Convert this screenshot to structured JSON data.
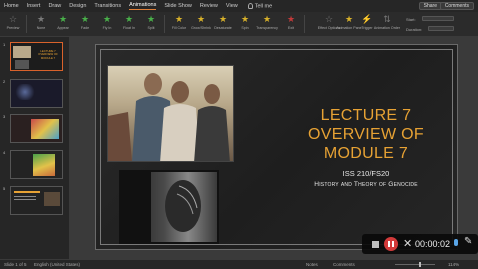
{
  "menubar": {
    "items": [
      "Home",
      "Insert",
      "Draw",
      "Design",
      "Transitions",
      "Animations",
      "Slide Show",
      "Review",
      "View"
    ],
    "active": "Animations",
    "tell_me": "Tell me",
    "share_label": "Share",
    "comments_label": "Comments"
  },
  "ribbon": {
    "preview_label": "Preview",
    "effects": [
      {
        "label": "None",
        "icon": "star-gray-icon"
      },
      {
        "label": "Appear",
        "icon": "star-green-icon"
      },
      {
        "label": "Fade",
        "icon": "star-green-icon"
      },
      {
        "label": "Fly In",
        "icon": "star-green-icon"
      },
      {
        "label": "Float In",
        "icon": "star-green-icon"
      },
      {
        "label": "Split",
        "icon": "star-green-icon"
      },
      {
        "label": "Wipe",
        "icon": "star-green-icon"
      },
      {
        "label": "Fill Color",
        "icon": "star-yellow-icon"
      },
      {
        "label": "Grow/Shrink",
        "icon": "star-yellow-icon"
      },
      {
        "label": "Desaturate",
        "icon": "star-yellow-icon"
      },
      {
        "label": "Spin",
        "icon": "star-yellow-icon"
      },
      {
        "label": "Transparency",
        "icon": "star-yellow-icon"
      },
      {
        "label": "Exit",
        "icon": "star-red-icon"
      }
    ],
    "effect_options": "Effect Options",
    "animation_pane": "Animation Pane",
    "trigger": "Trigger",
    "reorder": "Animation Order",
    "start_label": "Start:",
    "duration_label": "Duration:"
  },
  "thumbnails": [
    {
      "num": "1",
      "title": "LECTURE 7 OVERVIEW OF MODULE 7"
    },
    {
      "num": "2",
      "title": ""
    },
    {
      "num": "3",
      "title": ""
    },
    {
      "num": "4",
      "title": ""
    },
    {
      "num": "5",
      "title": ""
    }
  ],
  "slide": {
    "title_line1": "LECTURE 7",
    "title_line2": "OVERVIEW OF",
    "title_line3": "MODULE 7",
    "course": "ISS 210/FS20",
    "course_title": "History and Theory of Genocide"
  },
  "statusbar": {
    "slide_info": "Slide 1 of 5",
    "language": "English (United States)",
    "notes": "Notes",
    "comments": "Comments",
    "zoom": "114%"
  },
  "recorder": {
    "time": "00:00:02"
  },
  "colors": {
    "accent_orange": "#e0803a",
    "title_gold": "#e7a234",
    "record_red": "#d23a3a"
  }
}
